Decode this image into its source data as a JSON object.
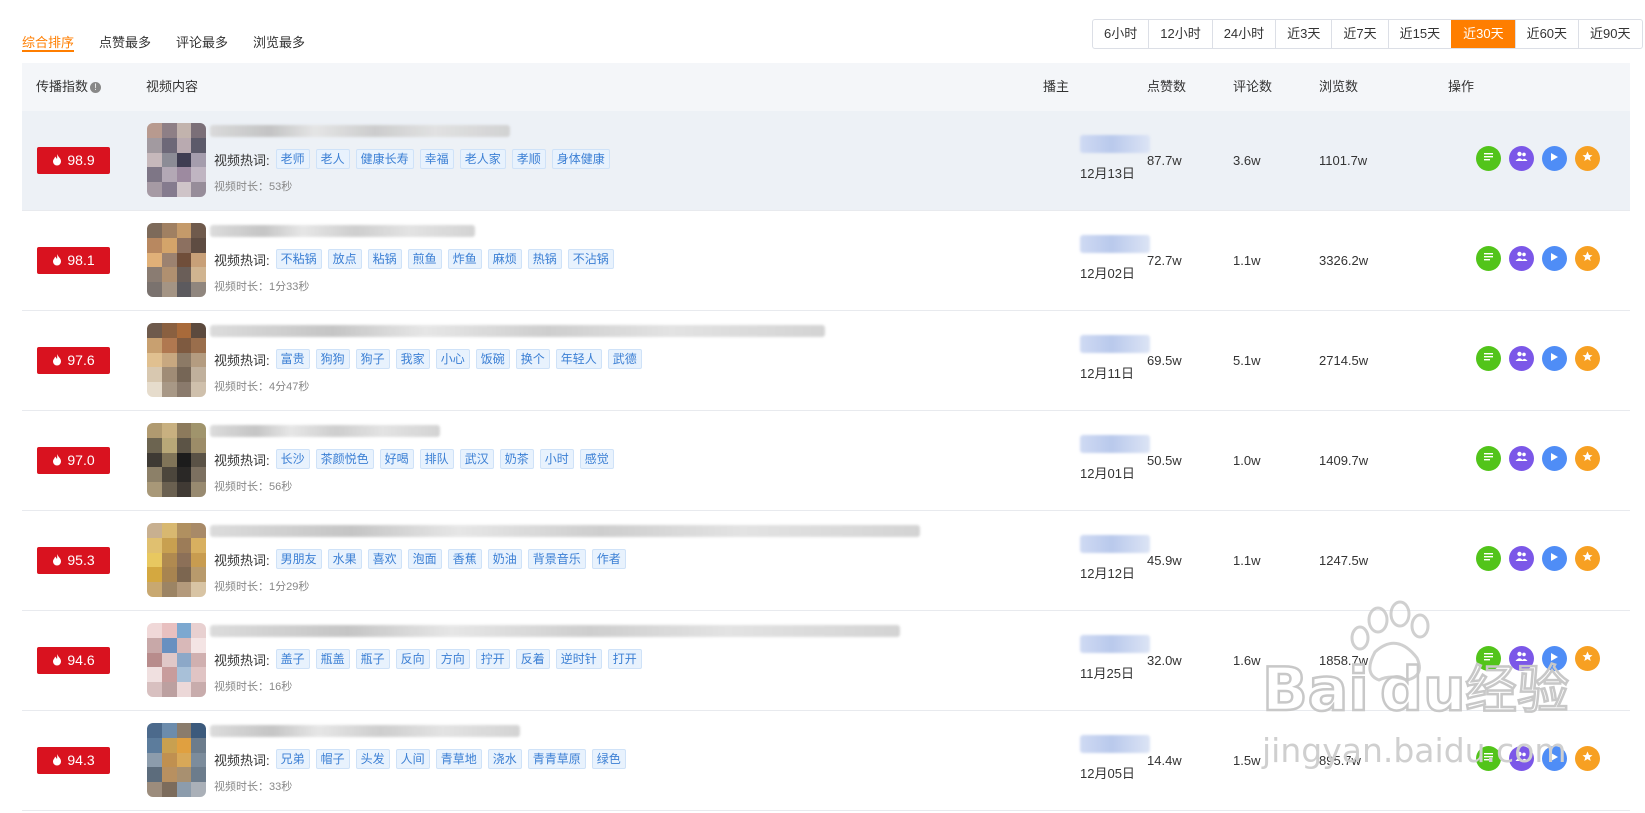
{
  "tabs": [
    "综合排序",
    "点赞最多",
    "评论最多",
    "浏览最多"
  ],
  "time_ranges": [
    "6小时",
    "12小时",
    "24小时",
    "近3天",
    "近7天",
    "近15天",
    "近30天",
    "近60天",
    "近90天"
  ],
  "active_range": "近30天",
  "columns": {
    "index": "传播指数",
    "content": "视频内容",
    "anchor": "播主",
    "likes": "点赞数",
    "comments": "评论数",
    "views": "浏览数",
    "actions": "操作"
  },
  "kw_label": "视频热词:",
  "duration_prefix": "视频时长：",
  "rows": [
    {
      "score": "98.9",
      "tags": [
        "老师",
        "老人",
        "健康长寿",
        "幸福",
        "老人家",
        "孝顺",
        "身体健康"
      ],
      "duration": "53秒",
      "date": "12月13日",
      "likes": "87.7w",
      "comments": "3.6w",
      "views": "1101.7w",
      "highlight": true
    },
    {
      "score": "98.1",
      "tags": [
        "不粘锅",
        "放点",
        "粘锅",
        "煎鱼",
        "炸鱼",
        "麻烦",
        "热锅",
        "不沾锅"
      ],
      "duration": "1分33秒",
      "date": "12月02日",
      "likes": "72.7w",
      "comments": "1.1w",
      "views": "3326.2w",
      "highlight": false
    },
    {
      "score": "97.6",
      "tags": [
        "富贵",
        "狗狗",
        "狗子",
        "我家",
        "小心",
        "饭碗",
        "换个",
        "年轻人",
        "武德"
      ],
      "duration": "4分47秒",
      "date": "12月11日",
      "likes": "69.5w",
      "comments": "5.1w",
      "views": "2714.5w",
      "highlight": false
    },
    {
      "score": "97.0",
      "tags": [
        "长沙",
        "茶颜悦色",
        "好喝",
        "排队",
        "武汉",
        "奶茶",
        "小时",
        "感觉"
      ],
      "duration": "56秒",
      "date": "12月01日",
      "likes": "50.5w",
      "comments": "1.0w",
      "views": "1409.7w",
      "highlight": false
    },
    {
      "score": "95.3",
      "tags": [
        "男朋友",
        "水果",
        "喜欢",
        "泡面",
        "香蕉",
        "奶油",
        "背景音乐",
        "作者"
      ],
      "duration": "1分29秒",
      "date": "12月12日",
      "likes": "45.9w",
      "comments": "1.1w",
      "views": "1247.5w",
      "highlight": false
    },
    {
      "score": "94.6",
      "tags": [
        "盖子",
        "瓶盖",
        "瓶子",
        "反向",
        "方向",
        "拧开",
        "反着",
        "逆时针",
        "打开"
      ],
      "duration": "16秒",
      "date": "11月25日",
      "likes": "32.0w",
      "comments": "1.6w",
      "views": "1858.7w",
      "highlight": false
    },
    {
      "score": "94.3",
      "tags": [
        "兄弟",
        "帽子",
        "头发",
        "人间",
        "青草地",
        "浇水",
        "青青草原",
        "绿色"
      ],
      "duration": "33秒",
      "date": "12月05日",
      "likes": "14.4w",
      "comments": "1.5w",
      "views": "895.7w",
      "highlight": false
    }
  ],
  "icons": {
    "score": "flame-icon",
    "op1": "list-icon",
    "op2": "users-icon",
    "op3": "play-icon",
    "op4": "star-icon"
  },
  "colors": {
    "accent": "#ff7e00",
    "score_bg": "#d9121f",
    "op_green": "#52c41a",
    "op_purple": "#7b57e8",
    "op_blue": "#4f8df6",
    "op_orange": "#f7a022"
  },
  "watermark": {
    "brand": "Bai",
    "brand2": "du",
    "cn": "经验",
    "url": "jingyan.baidu.com"
  }
}
